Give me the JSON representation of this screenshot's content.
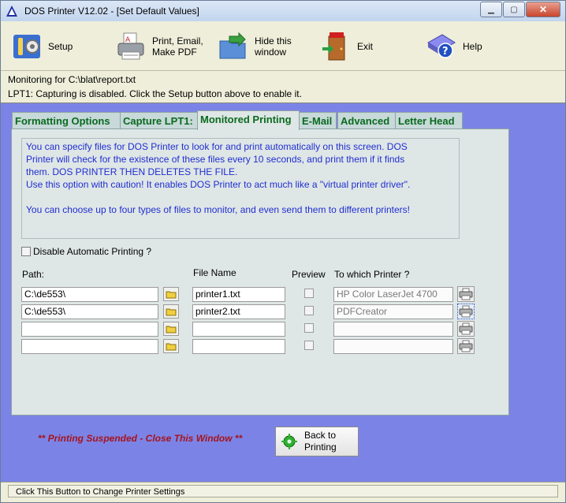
{
  "window": {
    "title": "DOS Printer V12.02 - [Set Default Values]",
    "minimize": "▁",
    "maximize": "▢",
    "close": "✕"
  },
  "toolbar": {
    "setup": {
      "label_line1": "Setup",
      "icon": "wrench-gear-icon"
    },
    "print": {
      "label_line1": "Print, Email,",
      "label_line2": "Make PDF",
      "icon": "printer-pdf-icon"
    },
    "hide": {
      "label_line1": "Hide this",
      "label_line2": "window",
      "icon": "folder-arrow-icon"
    },
    "exit": {
      "label_line1": "Exit",
      "icon": "exit-door-icon"
    },
    "help": {
      "label_line1": "Help",
      "icon": "help-book-icon"
    }
  },
  "status": {
    "monitoring": "Monitoring for C:\\blat\\report.txt",
    "lpt1": "LPT1: Capturing is disabled.  Click the Setup button above to enable it."
  },
  "tabs": [
    {
      "label": "Formatting  Options",
      "active": false
    },
    {
      "label": "Capture LPT1:",
      "active": false
    },
    {
      "label": "Monitored Printing",
      "active": true
    },
    {
      "label": "E-Mail",
      "active": false
    },
    {
      "label": "Advanced",
      "active": false
    },
    {
      "label": "Letter Head",
      "active": false
    }
  ],
  "info": {
    "line1": "You can specify files for DOS Printer to look for and print automatically on this screen.  DOS",
    "line2": "Printer will check for the existence of these files every 10 seconds, and print them if it finds",
    "line3": "them.  DOS PRINTER THEN DELETES THE FILE.",
    "line4": "Use this option with caution!  It enables DOS Printer to act much like a \"virtual printer driver\".",
    "line5": "You can choose up to four types of files to monitor, and even send them to different printers!"
  },
  "disable_auto": {
    "label": "Disable Automatic Printing ?",
    "checked": false
  },
  "columns": {
    "path": "Path:",
    "filename": "File Name",
    "preview": "Preview",
    "printer": "To which Printer ?"
  },
  "rows": [
    {
      "path": "C:\\de553\\",
      "filename": "printer1.txt",
      "preview": false,
      "printer": "HP Color LaserJet 4700"
    },
    {
      "path": "C:\\de553\\",
      "filename": "printer2.txt",
      "preview": false,
      "printer": "PDFCreator"
    },
    {
      "path": "",
      "filename": "",
      "preview": false,
      "printer": ""
    },
    {
      "path": "",
      "filename": "",
      "preview": false,
      "printer": ""
    }
  ],
  "suspended_text": "** Printing Suspended - Close This Window **",
  "back_button": {
    "line1": "Back to",
    "line2": "Printing"
  },
  "statusbar": "Click This Button to Change Printer Settings",
  "colors": {
    "window_bg": "#7b84e6",
    "tab_text": "#0a6a1e",
    "info_text": "#1f2fd0",
    "suspended_text": "#a6131e"
  }
}
